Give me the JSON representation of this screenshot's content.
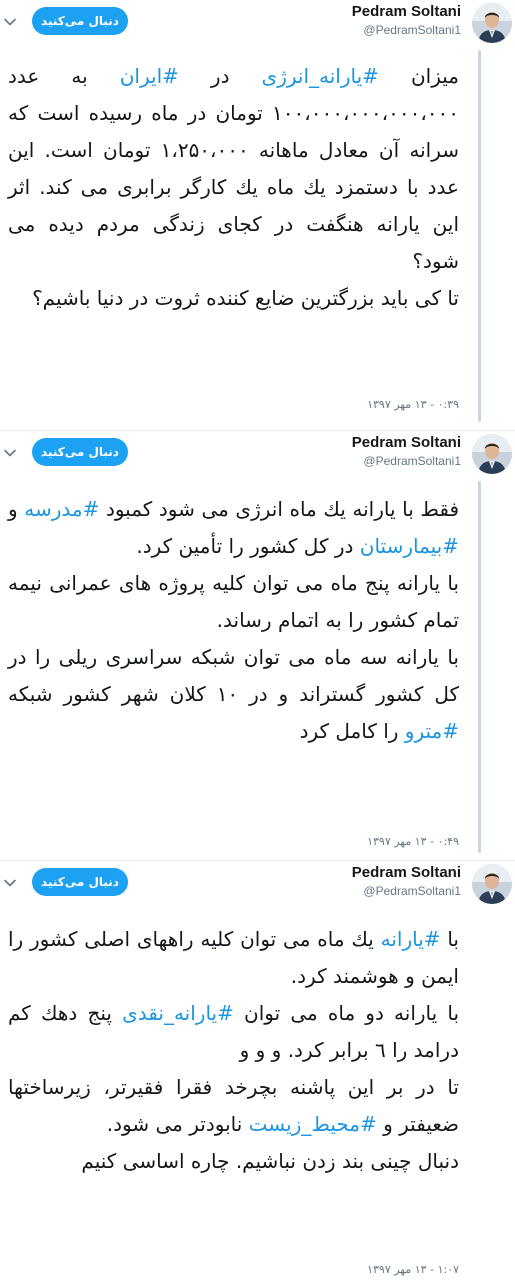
{
  "tweets": [
    {
      "author": {
        "name": "Pedram Soltani",
        "handle": "@PedramSoltani1"
      },
      "follow_label": "دنبال می‌کنید",
      "paragraphs": [
        [
          {
            "t": "میزان "
          },
          {
            "t": "#یارانه_انرژی",
            "tag": true
          },
          {
            "t": " در "
          },
          {
            "t": "#ایران",
            "tag": true
          },
          {
            "t": " به عدد ۱۰۰،۰۰۰،۰۰۰،۰۰۰،۰۰۰ تومان در ماه رسیده است که سرانه آن معادل ماهانه ۱،۲۵۰،۰۰۰ تومان است. این عدد با دستمزد یك ماه یك کارگر برابری می کند. اثر این یارانه هنگفت در کجای زندگی مردم دیده می شود؟"
          }
        ],
        [
          {
            "t": "تا کی باید بزرگترین ضایع کننده ثروت در دنیا باشیم؟"
          }
        ]
      ],
      "timestamp": "۰:۳۹ - ۱۳ مهر ۱۳۹۷"
    },
    {
      "author": {
        "name": "Pedram Soltani",
        "handle": "@PedramSoltani1"
      },
      "follow_label": "دنبال می‌کنید",
      "paragraphs": [
        [
          {
            "t": "فقط با یارانه یك ماه انرژی می شود کمبود "
          },
          {
            "t": "#مدرسه",
            "tag": true
          },
          {
            "t": " و "
          },
          {
            "t": "#بیمارستان",
            "tag": true
          },
          {
            "t": " در کل کشور را تأمین کرد."
          }
        ],
        [
          {
            "t": "با یارانه پنج ماه می توان کلیه پروژه های عمرانی نیمه تمام کشور را به اتمام رساند."
          }
        ],
        [
          {
            "t": "با یارانه سه ماه می توان شبکه سراسری ریلی را در کل کشور گستراند و در ۱۰ کلان شهر کشور شبکه "
          },
          {
            "t": "#مترو",
            "tag": true
          },
          {
            "t": " را کامل کرد"
          }
        ]
      ],
      "timestamp": "۰:۴۹ - ۱۳ مهر ۱۳۹۷"
    },
    {
      "author": {
        "name": "Pedram Soltani",
        "handle": "@PedramSoltani1"
      },
      "follow_label": "دنبال می‌کنید",
      "paragraphs": [
        [
          {
            "t": "با "
          },
          {
            "t": "#یارانه",
            "tag": true
          },
          {
            "t": " یك ماه می توان کلیه راههای اصلی کشور را ایمن و هوشمند کرد."
          }
        ],
        [
          {
            "t": "با یارانه دو ماه می توان "
          },
          {
            "t": "#یارانه_نقدی",
            "tag": true
          },
          {
            "t": " پنج دهك کم درامد را ٦ برابر کرد. و و و"
          }
        ],
        [
          {
            "t": "تا در بر این پاشنه بچرخد فقرا فقیرتر، زیرساختها ضعیفتر و "
          },
          {
            "t": "#محیط_زیست",
            "tag": true
          },
          {
            "t": " نابودتر می شود."
          }
        ],
        [
          {
            "t": "دنبال چینی بند زدن نباشیم. چاره اساسی کنیم"
          }
        ]
      ],
      "timestamp": "۱:۰۷ - ۱۳ مهر ۱۳۹۷"
    }
  ],
  "colors": {
    "accent": "#1da1f2",
    "link": "#1b95e0",
    "muted": "#657786",
    "thread_line": "#ccd6dd"
  },
  "icons": {
    "menu": "chevron-down-icon"
  }
}
